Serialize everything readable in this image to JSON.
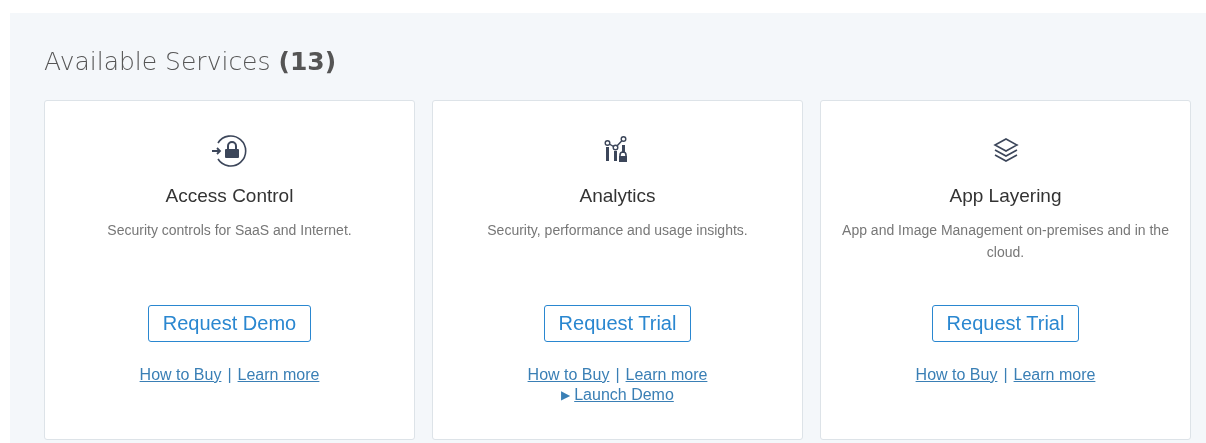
{
  "section": {
    "title": "Available Services **(13)**"
  },
  "cards": [
    {
      "title": "Access Control",
      "description": "Security controls for SaaS and Internet.",
      "button": "Request Demo",
      "links": [
        "How to Buy",
        "Learn more"
      ],
      "separator": "|"
    },
    {
      "title": "Analytics",
      "description": "Security, performance and usage insights.",
      "button": "Request Trial",
      "links": [
        "How to Buy",
        "Learn more"
      ],
      "separator": "|",
      "extra_link": {
        "marker": "▶",
        "label": "Launch Demo"
      }
    },
    {
      "title": "App Layering",
      "description": "App and Image Management on-premises and in the cloud.",
      "button": "Request Trial",
      "links": [
        "How to Buy",
        "Learn more"
      ],
      "separator": "|"
    }
  ]
}
